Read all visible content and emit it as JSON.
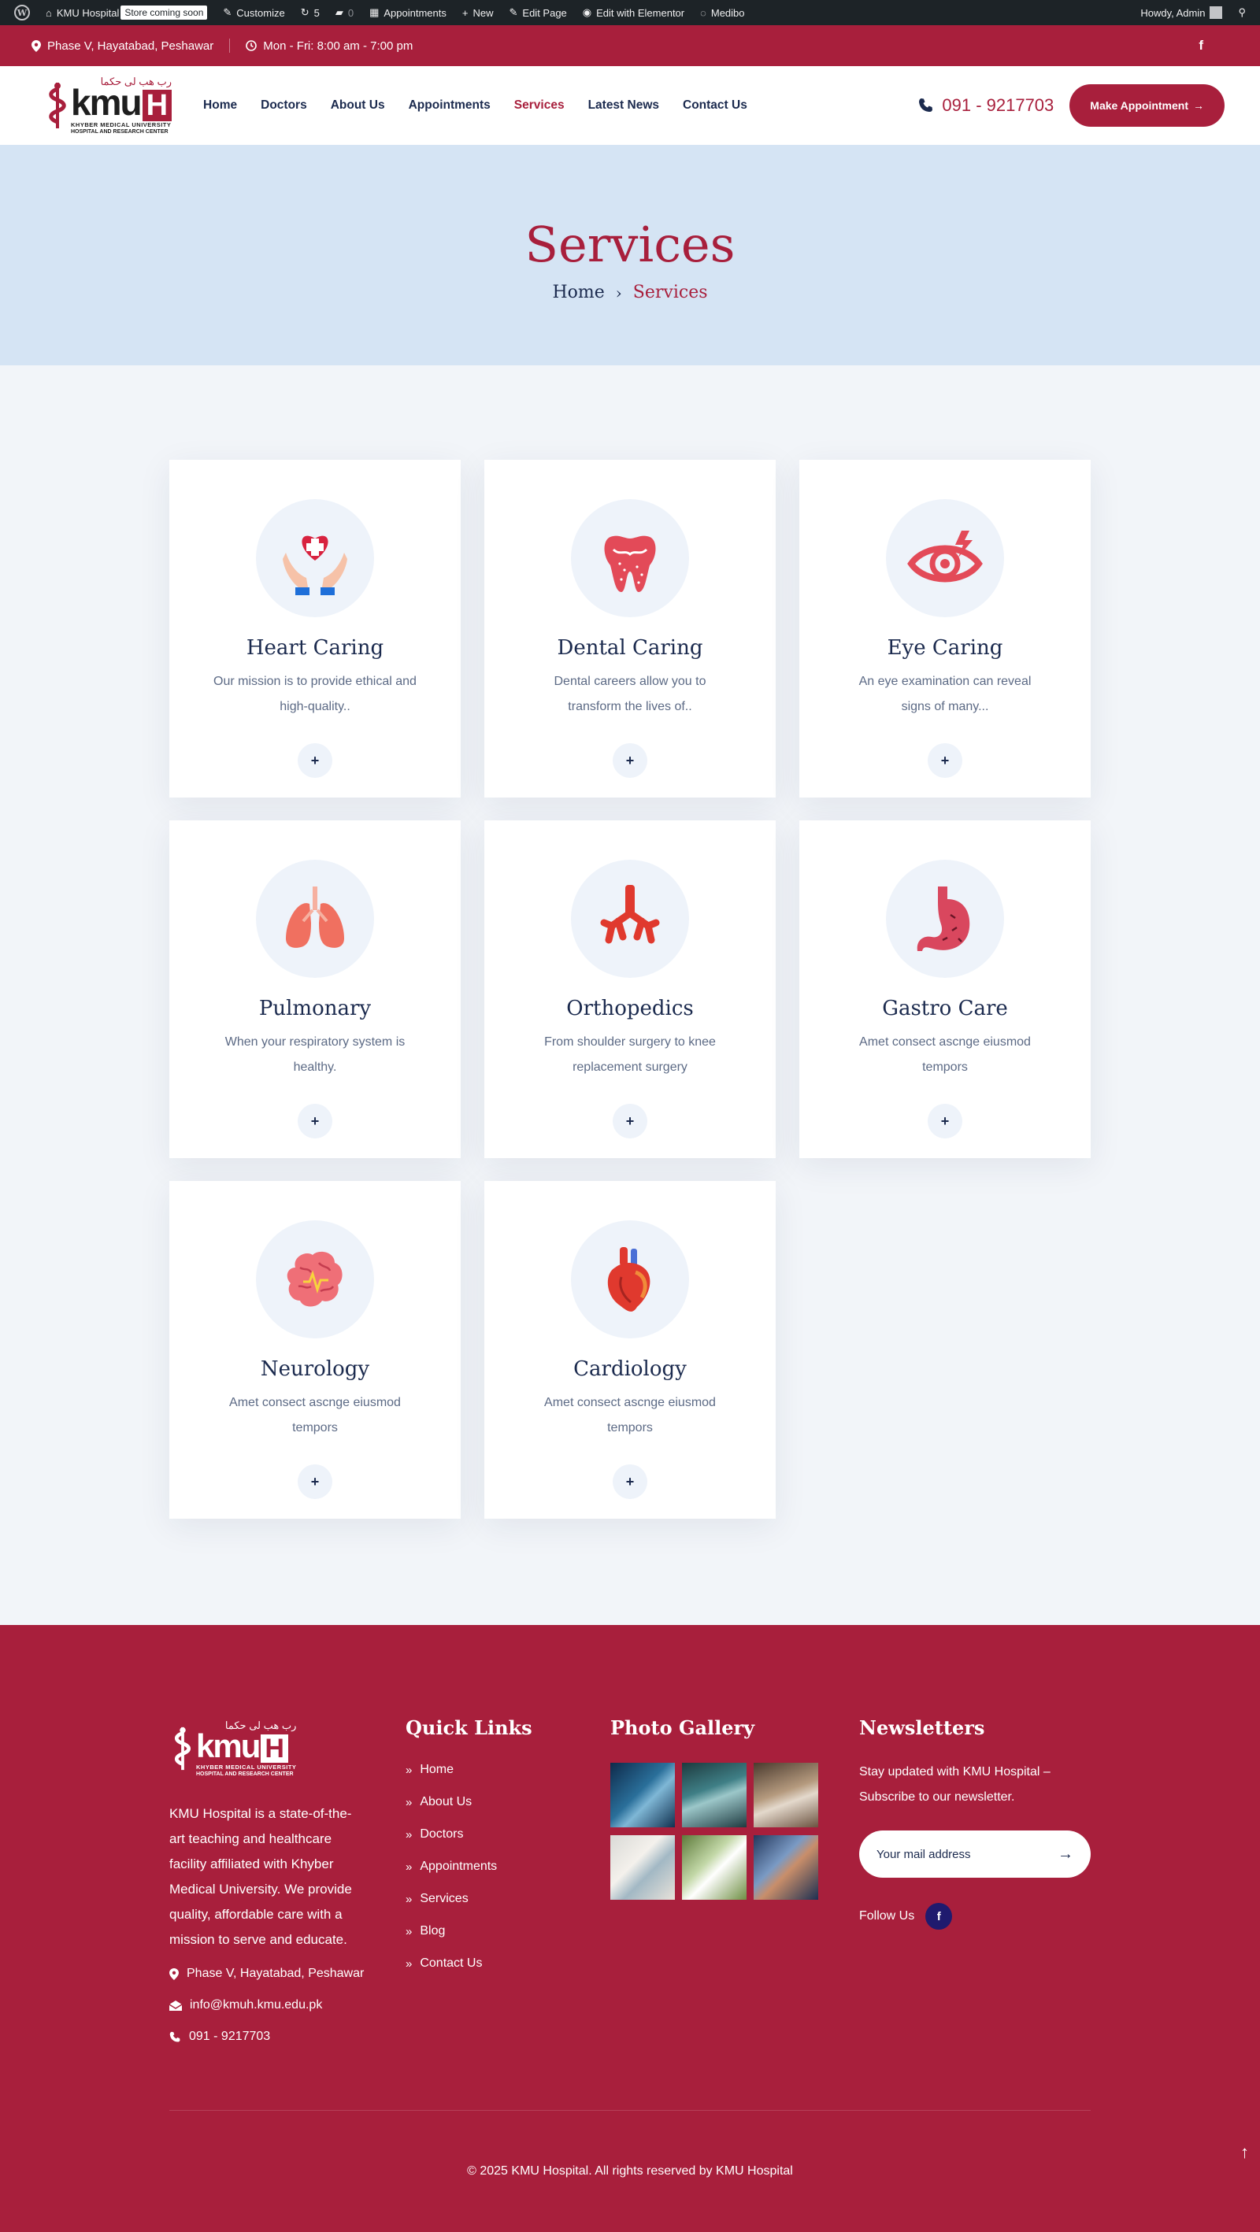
{
  "admin_bar": {
    "site_name": "KMU Hospital",
    "badge": "Store coming soon",
    "customize": "Customize",
    "updates_count": "5",
    "comments_count": "0",
    "appointments": "Appointments",
    "new": "New",
    "edit_page": "Edit Page",
    "edit_elementor": "Edit with Elementor",
    "theme": "Medibo",
    "howdy": "Howdy, Admin"
  },
  "info_bar": {
    "address": "Phase V, Hayatabad, Peshawar",
    "hours": "Mon - Fri: 8:00 am - 7:00 pm"
  },
  "logo": {
    "urdu": "رب هب لی حكما",
    "kmu": "kmu",
    "h": "H",
    "line1": "KHYBER MEDICAL UNIVERSITY",
    "line2": "HOSPITAL AND RESEARCH CENTER"
  },
  "nav": {
    "items": [
      "Home",
      "Doctors",
      "About Us",
      "Appointments",
      "Services",
      "Latest News",
      "Contact Us"
    ],
    "active": "Services"
  },
  "header": {
    "phone": "091 - 9217703",
    "cta": "Make Appointment"
  },
  "hero": {
    "title": "Services",
    "breadcrumb_home": "Home",
    "breadcrumb_current": "Services"
  },
  "services": [
    {
      "title": "Heart Caring",
      "desc": "Our mission is to provide ethical and high-quality..",
      "icon": "heart-hands-icon"
    },
    {
      "title": "Dental Caring",
      "desc": "Dental careers allow you to transform the lives of..",
      "icon": "tooth-icon"
    },
    {
      "title": "Eye Caring",
      "desc": "An eye examination can reveal signs of many...",
      "icon": "eye-icon"
    },
    {
      "title": "Pulmonary",
      "desc": "When your respiratory system is healthy.",
      "icon": "lungs-icon"
    },
    {
      "title": "Orthopedics",
      "desc": "From shoulder surgery to knee replacement surgery",
      "icon": "bronchi-icon"
    },
    {
      "title": "Gastro Care",
      "desc": "Amet consect ascnge eiusmod tempors",
      "icon": "stomach-icon"
    },
    {
      "title": "Neurology",
      "desc": "Amet consect ascnge eiusmod tempors",
      "icon": "brain-icon"
    },
    {
      "title": "Cardiology",
      "desc": "Amet consect ascnge eiusmod tempors",
      "icon": "heart-organ-icon"
    }
  ],
  "footer": {
    "about": "KMU Hospital is a state-of-the-art teaching and healthcare facility affiliated with Khyber Medical University. We provide quality, affordable care with a mission to serve and educate.",
    "address": "Phase V, Hayatabad, Peshawar",
    "email": "info@kmuh.kmu.edu.pk",
    "phone": "091 - 9217703",
    "quick_links_title": "Quick Links",
    "quick_links": [
      "Home",
      "About Us",
      "Doctors",
      "Appointments",
      "Services",
      "Blog",
      "Contact Us"
    ],
    "gallery_title": "Photo Gallery",
    "newsletter_title": "Newsletters",
    "newsletter_text": "Stay updated with KMU Hospital – Subscribe to our newsletter.",
    "newsletter_placeholder": "Your mail address",
    "follow": "Follow Us",
    "copyright": "© 2025 KMU Hospital. All rights reserved by KMU Hospital"
  },
  "colors": {
    "brand": "#a81f3c",
    "navy": "#1b2a4e",
    "hero_bg": "#d5e4f4"
  }
}
